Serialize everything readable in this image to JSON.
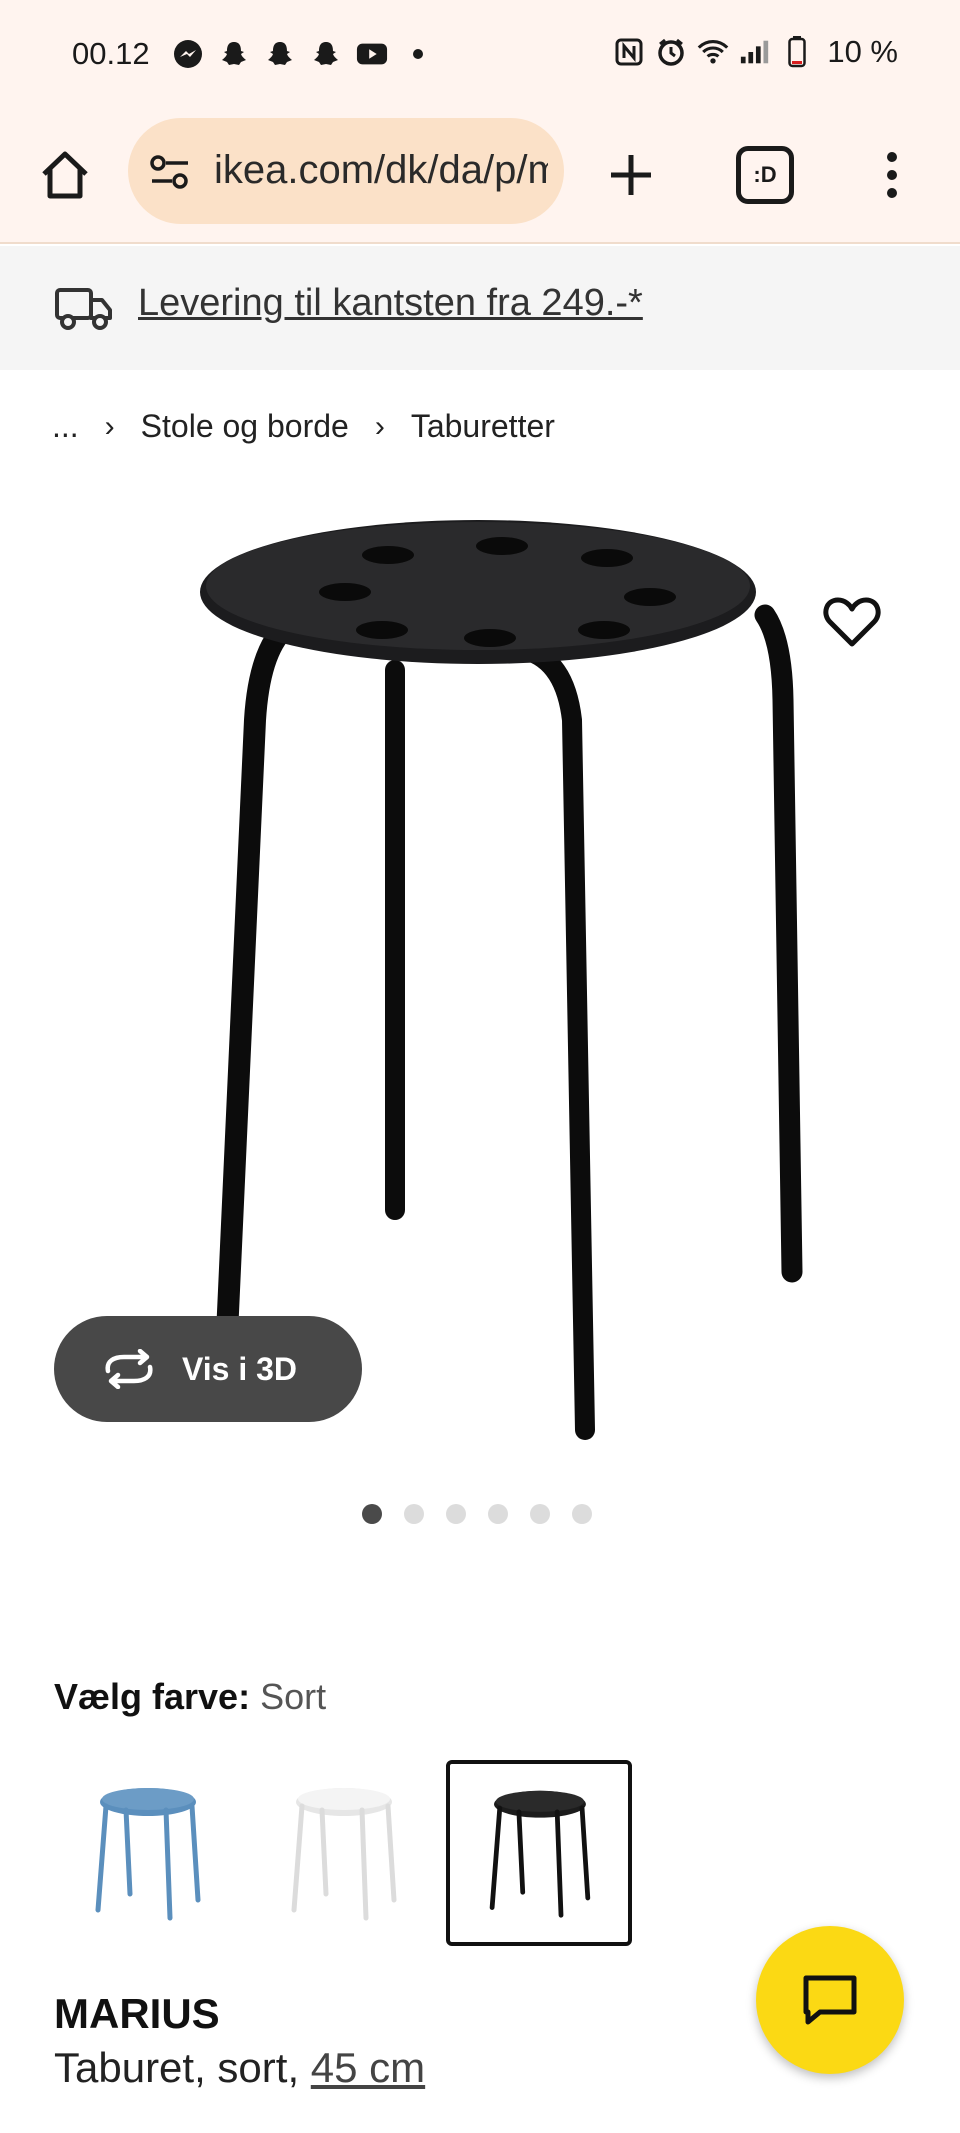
{
  "status_bar": {
    "time": "00.12",
    "left_icons": [
      "messenger-icon",
      "snapchat-icon",
      "snapchat-icon",
      "snapchat-icon",
      "youtube-icon",
      "dot-icon"
    ],
    "right_icons": [
      "nfc-icon",
      "alarm-icon",
      "wifi-icon",
      "signal-icon",
      "battery-icon"
    ],
    "battery": "10 %"
  },
  "browser": {
    "url": "ikea.com/dk/da/p/marius",
    "tab_switcher_label": ":D"
  },
  "banner": {
    "text": "Levering til kantsten fra 249.-*"
  },
  "breadcrumb": {
    "ellipsis": "...",
    "items": [
      "Stole og borde",
      "Taburetter"
    ],
    "separator": "›"
  },
  "product_image": {
    "vis3d_label": "Vis i 3D",
    "carousel_count": 6,
    "carousel_active": 0
  },
  "color_picker": {
    "heading": "Vælg farve:",
    "selected": "Sort",
    "options": [
      {
        "name": "blue",
        "color": "#5b8fbd"
      },
      {
        "name": "white",
        "color": "#f4f4f4"
      },
      {
        "name": "black",
        "color": "#1c1c1c",
        "selected": true
      }
    ]
  },
  "product": {
    "name": "MARIUS",
    "desc_prefix": "Taburet, sort, ",
    "size_link": "45 cm"
  },
  "colors": {
    "status_bg": "#fff4ef",
    "url_pill": "#fbe1c8",
    "chat_fab": "#fbd914",
    "vis3d_bg": "#484848"
  }
}
